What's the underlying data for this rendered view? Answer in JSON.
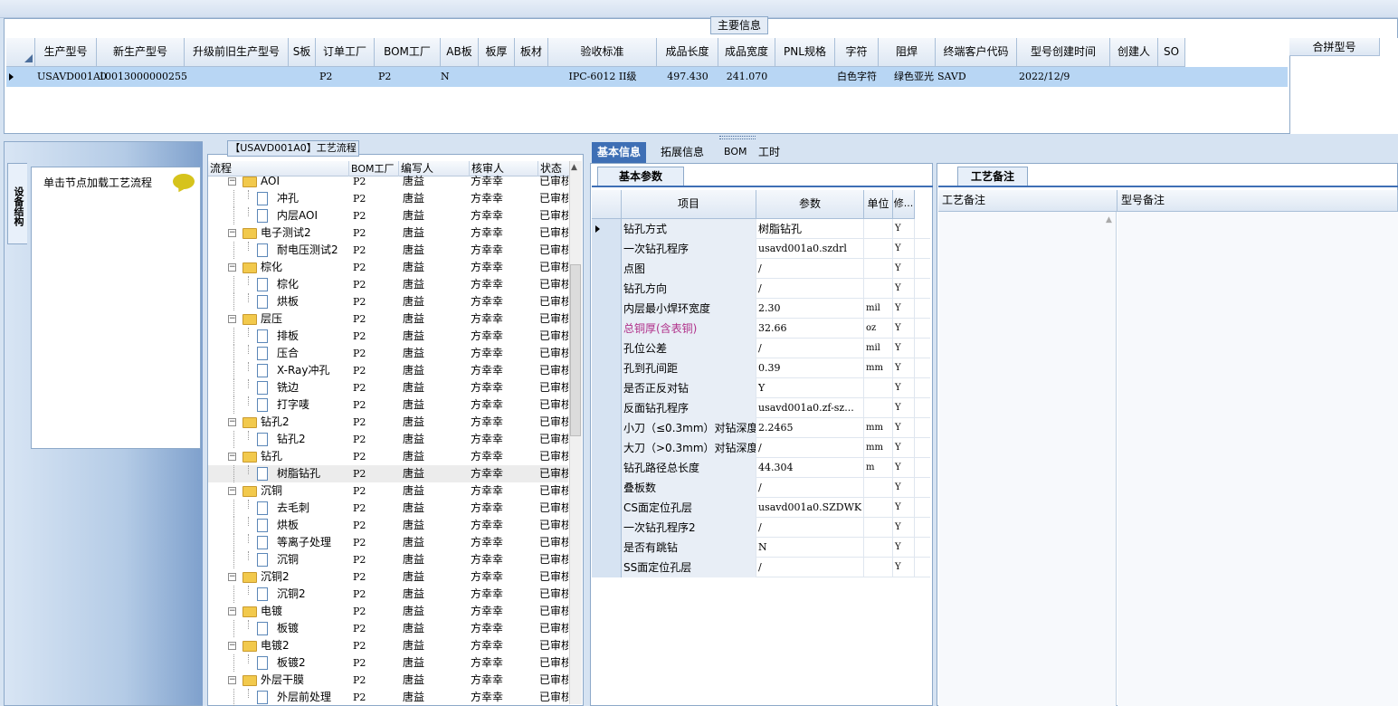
{
  "main": {
    "title": "主要信息",
    "columns": [
      "生产型号",
      "新生产型号",
      "升级前旧生产型号",
      "S板",
      "订单工厂",
      "BOM工厂",
      "AB板",
      "板厚",
      "板材",
      "验收标准",
      "成品长度",
      "成品宽度",
      "PNL规格",
      "字符",
      "阻焊",
      "终端客户代码",
      "型号创建时间",
      "创建人",
      "SO"
    ],
    "row": [
      "USAVD001A0",
      "10013000000255",
      "",
      "",
      "P2",
      "P2",
      "N",
      "",
      "",
      "IPC-6012 II级",
      "497.430",
      "241.070",
      "",
      "白色字符",
      "绿色亚光",
      "SAVD",
      "2022/12/9",
      "",
      ""
    ],
    "merge_header": "合拼型号"
  },
  "left": {
    "vertical_tab": "设备结构",
    "hint": "单击节点加载工艺流程"
  },
  "tree": {
    "title": "【USAVD001A0】工艺流程",
    "columns": [
      "流程",
      "BOM工厂",
      "编写人",
      "核审人",
      "状态"
    ],
    "rows": [
      {
        "level": 0,
        "name": "AOI",
        "bom": "P2",
        "writer": "唐益",
        "reviewer": "方幸幸",
        "status": "已审核"
      },
      {
        "level": 1,
        "name": "冲孔",
        "bom": "P2",
        "writer": "唐益",
        "reviewer": "方幸幸",
        "status": "已审核"
      },
      {
        "level": 1,
        "name": "内层AOI",
        "bom": "P2",
        "writer": "唐益",
        "reviewer": "方幸幸",
        "status": "已审核"
      },
      {
        "level": 0,
        "name": "电子测试2",
        "bom": "P2",
        "writer": "唐益",
        "reviewer": "方幸幸",
        "status": "已审核"
      },
      {
        "level": 1,
        "name": "耐电压测试2",
        "bom": "P2",
        "writer": "唐益",
        "reviewer": "方幸幸",
        "status": "已审核"
      },
      {
        "level": 0,
        "name": "棕化",
        "bom": "P2",
        "writer": "唐益",
        "reviewer": "方幸幸",
        "status": "已审核"
      },
      {
        "level": 1,
        "name": "棕化",
        "bom": "P2",
        "writer": "唐益",
        "reviewer": "方幸幸",
        "status": "已审核"
      },
      {
        "level": 1,
        "name": "烘板",
        "bom": "P2",
        "writer": "唐益",
        "reviewer": "方幸幸",
        "status": "已审核"
      },
      {
        "level": 0,
        "name": "层压",
        "bom": "P2",
        "writer": "唐益",
        "reviewer": "方幸幸",
        "status": "已审核"
      },
      {
        "level": 1,
        "name": "排板",
        "bom": "P2",
        "writer": "唐益",
        "reviewer": "方幸幸",
        "status": "已审核"
      },
      {
        "level": 1,
        "name": "压合",
        "bom": "P2",
        "writer": "唐益",
        "reviewer": "方幸幸",
        "status": "已审核"
      },
      {
        "level": 1,
        "name": "X-Ray冲孔",
        "bom": "P2",
        "writer": "唐益",
        "reviewer": "方幸幸",
        "status": "已审核"
      },
      {
        "level": 1,
        "name": "铣边",
        "bom": "P2",
        "writer": "唐益",
        "reviewer": "方幸幸",
        "status": "已审核"
      },
      {
        "level": 1,
        "name": "打字唛",
        "bom": "P2",
        "writer": "唐益",
        "reviewer": "方幸幸",
        "status": "已审核"
      },
      {
        "level": 0,
        "name": "钻孔2",
        "bom": "P2",
        "writer": "唐益",
        "reviewer": "方幸幸",
        "status": "已审核"
      },
      {
        "level": 1,
        "name": "钻孔2",
        "bom": "P2",
        "writer": "唐益",
        "reviewer": "方幸幸",
        "status": "已审核"
      },
      {
        "level": 0,
        "name": "钻孔",
        "bom": "P2",
        "writer": "唐益",
        "reviewer": "方幸幸",
        "status": "已审核"
      },
      {
        "level": 1,
        "name": "树脂钻孔",
        "bom": "P2",
        "writer": "唐益",
        "reviewer": "方幸幸",
        "status": "已审核",
        "selected": true
      },
      {
        "level": 0,
        "name": "沉铜",
        "bom": "P2",
        "writer": "唐益",
        "reviewer": "方幸幸",
        "status": "已审核"
      },
      {
        "level": 1,
        "name": "去毛刺",
        "bom": "P2",
        "writer": "唐益",
        "reviewer": "方幸幸",
        "status": "已审核"
      },
      {
        "level": 1,
        "name": "烘板",
        "bom": "P2",
        "writer": "唐益",
        "reviewer": "方幸幸",
        "status": "已审核"
      },
      {
        "level": 1,
        "name": "等离子处理",
        "bom": "P2",
        "writer": "唐益",
        "reviewer": "方幸幸",
        "status": "已审核"
      },
      {
        "level": 1,
        "name": "沉铜",
        "bom": "P2",
        "writer": "唐益",
        "reviewer": "方幸幸",
        "status": "已审核"
      },
      {
        "level": 0,
        "name": "沉铜2",
        "bom": "P2",
        "writer": "唐益",
        "reviewer": "方幸幸",
        "status": "已审核"
      },
      {
        "level": 1,
        "name": "沉铜2",
        "bom": "P2",
        "writer": "唐益",
        "reviewer": "方幸幸",
        "status": "已审核"
      },
      {
        "level": 0,
        "name": "电镀",
        "bom": "P2",
        "writer": "唐益",
        "reviewer": "方幸幸",
        "status": "已审核"
      },
      {
        "level": 1,
        "name": "板镀",
        "bom": "P2",
        "writer": "唐益",
        "reviewer": "方幸幸",
        "status": "已审核"
      },
      {
        "level": 0,
        "name": "电镀2",
        "bom": "P2",
        "writer": "唐益",
        "reviewer": "方幸幸",
        "status": "已审核"
      },
      {
        "level": 1,
        "name": "板镀2",
        "bom": "P2",
        "writer": "唐益",
        "reviewer": "方幸幸",
        "status": "已审核"
      },
      {
        "level": 0,
        "name": "外层干膜",
        "bom": "P2",
        "writer": "唐益",
        "reviewer": "方幸幸",
        "status": "已审核"
      },
      {
        "level": 1,
        "name": "外层前处理",
        "bom": "P2",
        "writer": "唐益",
        "reviewer": "方幸幸",
        "status": "已审核"
      }
    ]
  },
  "tabs": [
    "基本信息",
    "拓展信息",
    "BOM",
    "工时"
  ],
  "params": {
    "subtab": "基本参数",
    "columns": [
      "项目",
      "参数",
      "单位",
      "修..."
    ],
    "rows": [
      {
        "item": "钻孔方式",
        "value": "树脂钻孔",
        "unit": "",
        "mod": "Y",
        "current": true
      },
      {
        "item": "一次钻孔程序",
        "value": "usavd001a0.szdrl",
        "unit": "",
        "mod": "Y"
      },
      {
        "item": "点图",
        "value": "/",
        "unit": "",
        "mod": "Y"
      },
      {
        "item": "钻孔方向",
        "value": "/",
        "unit": "",
        "mod": "Y"
      },
      {
        "item": "内层最小焊环宽度",
        "value": "2.30",
        "unit": "mil",
        "mod": "Y"
      },
      {
        "item": "总铜厚(含表铜)",
        "value": "32.66",
        "unit": "oz",
        "mod": "Y",
        "highlight": true
      },
      {
        "item": "孔位公差",
        "value": "/",
        "unit": "mil",
        "mod": "Y"
      },
      {
        "item": "孔到孔间距",
        "value": "0.39",
        "unit": "mm",
        "mod": "Y"
      },
      {
        "item": "是否正反对钻",
        "value": "Y",
        "unit": "",
        "mod": "Y"
      },
      {
        "item": "反面钻孔程序",
        "value": "usavd001a0.zf-sz...",
        "unit": "",
        "mod": "Y"
      },
      {
        "item": "小刀（≤0.3mm）对钻深度",
        "value": "2.2465",
        "unit": "mm",
        "mod": "Y"
      },
      {
        "item": "大刀（>0.3mm）对钻深度",
        "value": "/",
        "unit": "mm",
        "mod": "Y"
      },
      {
        "item": "钻孔路径总长度",
        "value": "44.304",
        "unit": "m",
        "mod": "Y"
      },
      {
        "item": "叠板数",
        "value": "/",
        "unit": "",
        "mod": "Y"
      },
      {
        "item": "CS面定位孔层",
        "value": "usavd001a0.SZDWK",
        "unit": "",
        "mod": "Y"
      },
      {
        "item": "一次钻孔程序2",
        "value": "/",
        "unit": "",
        "mod": "Y"
      },
      {
        "item": "是否有跳钻",
        "value": "N",
        "unit": "",
        "mod": "Y"
      },
      {
        "item": "SS面定位孔层",
        "value": "/",
        "unit": "",
        "mod": "Y"
      }
    ]
  },
  "remarks": {
    "subtab": "工艺备注",
    "col1": "工艺备注",
    "col2": "型号备注"
  },
  "colors": {
    "accent": "#3e6fb5",
    "selected_row": "#b8d6f4",
    "highlight_text": "#b0308a"
  }
}
